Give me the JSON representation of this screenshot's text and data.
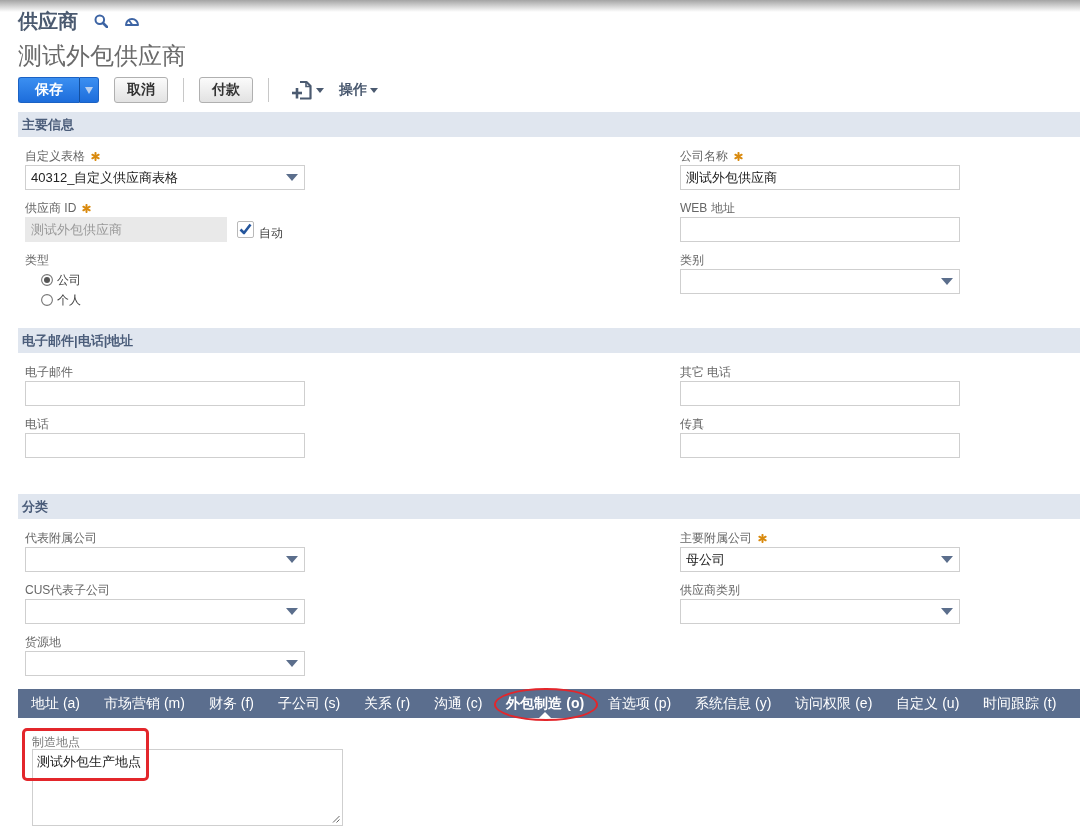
{
  "page": {
    "record_type": "供应商",
    "record_name": "测试外包供应商"
  },
  "toolbar": [
    {
      "kind": "split-primary",
      "label": "保存",
      "separator_before": false
    },
    {
      "kind": "button",
      "label": "取消",
      "separator_before": false
    },
    {
      "kind": "button",
      "label": "付款",
      "separator_before": true
    },
    {
      "kind": "new-record-menu",
      "separator_before": true
    },
    {
      "kind": "menu",
      "label": "操作",
      "separator_before": false
    }
  ],
  "sections": [
    {
      "title": "主要信息",
      "left": [
        {
          "kind": "select",
          "label": "自定义表格",
          "required": true,
          "disabled": false,
          "value": "40312_自定义供应商表格"
        },
        {
          "kind": "text",
          "label": "供应商 ID",
          "required": true,
          "disabled": true,
          "value": "测试外包供应商",
          "checkbox": {
            "label": "自动",
            "checked": true
          }
        },
        {
          "kind": "radio",
          "label": "类型",
          "required": false,
          "options": [
            {
              "label": "公司",
              "selected": true
            },
            {
              "label": "个人",
              "selected": false
            }
          ]
        }
      ],
      "right": [
        {
          "kind": "text",
          "label": "公司名称",
          "required": true,
          "disabled": false,
          "value": "测试外包供应商"
        },
        {
          "kind": "text",
          "label": "WEB 地址",
          "required": false,
          "disabled": false
        },
        {
          "kind": "select",
          "label": "类别",
          "required": false,
          "disabled": false
        }
      ]
    },
    {
      "title": "电子邮件|电话|地址",
      "left": [
        {
          "kind": "text",
          "label": "电子邮件",
          "required": false,
          "disabled": false
        },
        {
          "kind": "text",
          "label": "电话",
          "required": false,
          "disabled": false
        }
      ],
      "right": [
        {
          "kind": "text",
          "label": "其它 电话",
          "required": false,
          "disabled": false
        },
        {
          "kind": "text",
          "label": "传真",
          "required": false,
          "disabled": false
        }
      ]
    },
    {
      "title": "分类",
      "left": [
        {
          "kind": "select",
          "label": "代表附属公司",
          "required": false,
          "disabled": false
        },
        {
          "kind": "select",
          "label": "CUS代表子公司",
          "required": false,
          "disabled": false
        },
        {
          "kind": "select",
          "label": "货源地",
          "required": false,
          "disabled": false
        }
      ],
      "right": [
        {
          "kind": "select",
          "label": "主要附属公司",
          "required": true,
          "disabled": false,
          "value": "母公司"
        },
        {
          "kind": "select",
          "label": "供应商类别",
          "required": false,
          "disabled": false
        }
      ]
    }
  ],
  "subtabs": [
    {
      "label": "地址 (a)",
      "selected": false,
      "circled": false
    },
    {
      "label": "市场营销 (m)",
      "selected": false,
      "circled": false
    },
    {
      "label": "财务 (f)",
      "selected": false,
      "circled": false
    },
    {
      "label": "子公司 (s)",
      "selected": false,
      "circled": false
    },
    {
      "label": "关系 (r)",
      "selected": false,
      "circled": false
    },
    {
      "label": "沟通 (c)",
      "selected": false,
      "circled": false
    },
    {
      "label": "外包制造 (o)",
      "selected": true,
      "circled": true
    },
    {
      "label": "首选项 (p)",
      "selected": false,
      "circled": false
    },
    {
      "label": "系统信息 (y)",
      "selected": false,
      "circled": false
    },
    {
      "label": "访问权限 (e)",
      "selected": false,
      "circled": false
    },
    {
      "label": "自定义 (u)",
      "selected": false,
      "circled": false
    },
    {
      "label": "时间跟踪 (t)",
      "selected": false,
      "circled": false
    }
  ],
  "subtab_panel": {
    "fields": [
      {
        "kind": "textarea",
        "label": "制造地点",
        "value": "测试外包生产地点",
        "highlighted": true
      }
    ]
  }
}
